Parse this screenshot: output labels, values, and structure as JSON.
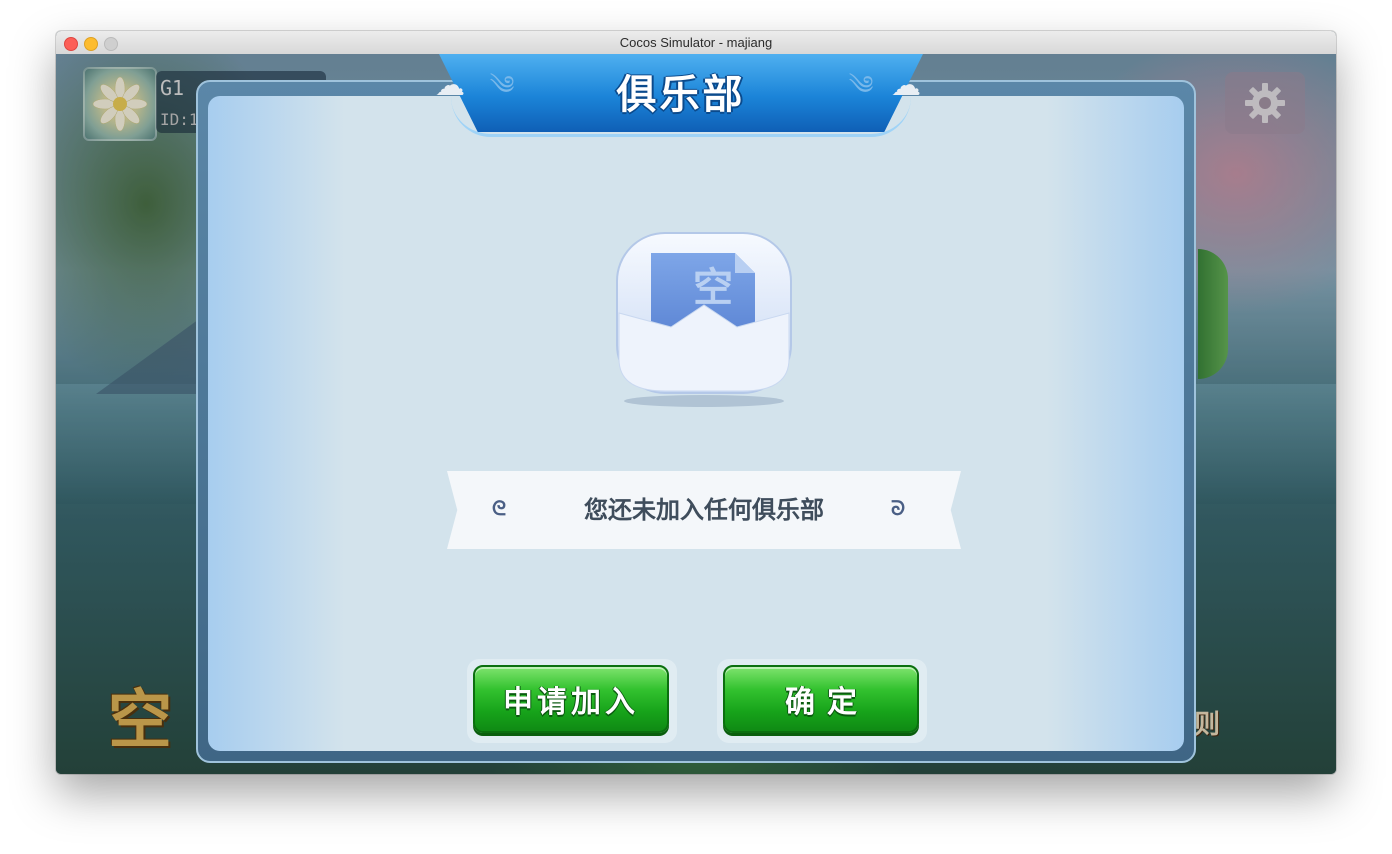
{
  "window": {
    "title": "Cocos Simulator - majiang"
  },
  "player": {
    "name": "G1",
    "id": "ID:1"
  },
  "background": {
    "left_title": "空",
    "right_label": "则"
  },
  "dialog": {
    "title": "俱乐部",
    "empty_icon_text": "空",
    "message": "您还未加入任何俱乐部",
    "buttons": {
      "apply": "申请加入",
      "confirm": "确定"
    }
  },
  "colors": {
    "banner": "#1b84d8",
    "panel": "#d3e3ec",
    "button_green": "#17a31a"
  },
  "icons": [
    "avatar-chrysanthemum-icon",
    "gear-icon",
    "cloud-ornament-icon",
    "empty-envelope-icon",
    "scroll-curl-icon"
  ]
}
